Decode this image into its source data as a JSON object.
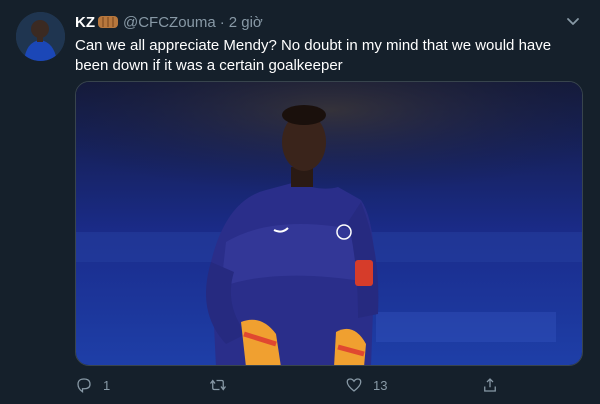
{
  "tweet": {
    "display_name": "KZ",
    "handle": "@CFCZouma",
    "separator": "·",
    "time": "2 giờ",
    "text": "Can we all appreciate Mendy? No doubt in my mind that we would have been down if it was a certain goalkeeper",
    "icons": [
      "fist-emoji-icon",
      "caret-down-icon",
      "reply-icon",
      "retweet-icon",
      "like-icon",
      "share-icon"
    ],
    "actions": {
      "reply_count": "1",
      "retweet_count": "",
      "like_count": "13"
    }
  }
}
